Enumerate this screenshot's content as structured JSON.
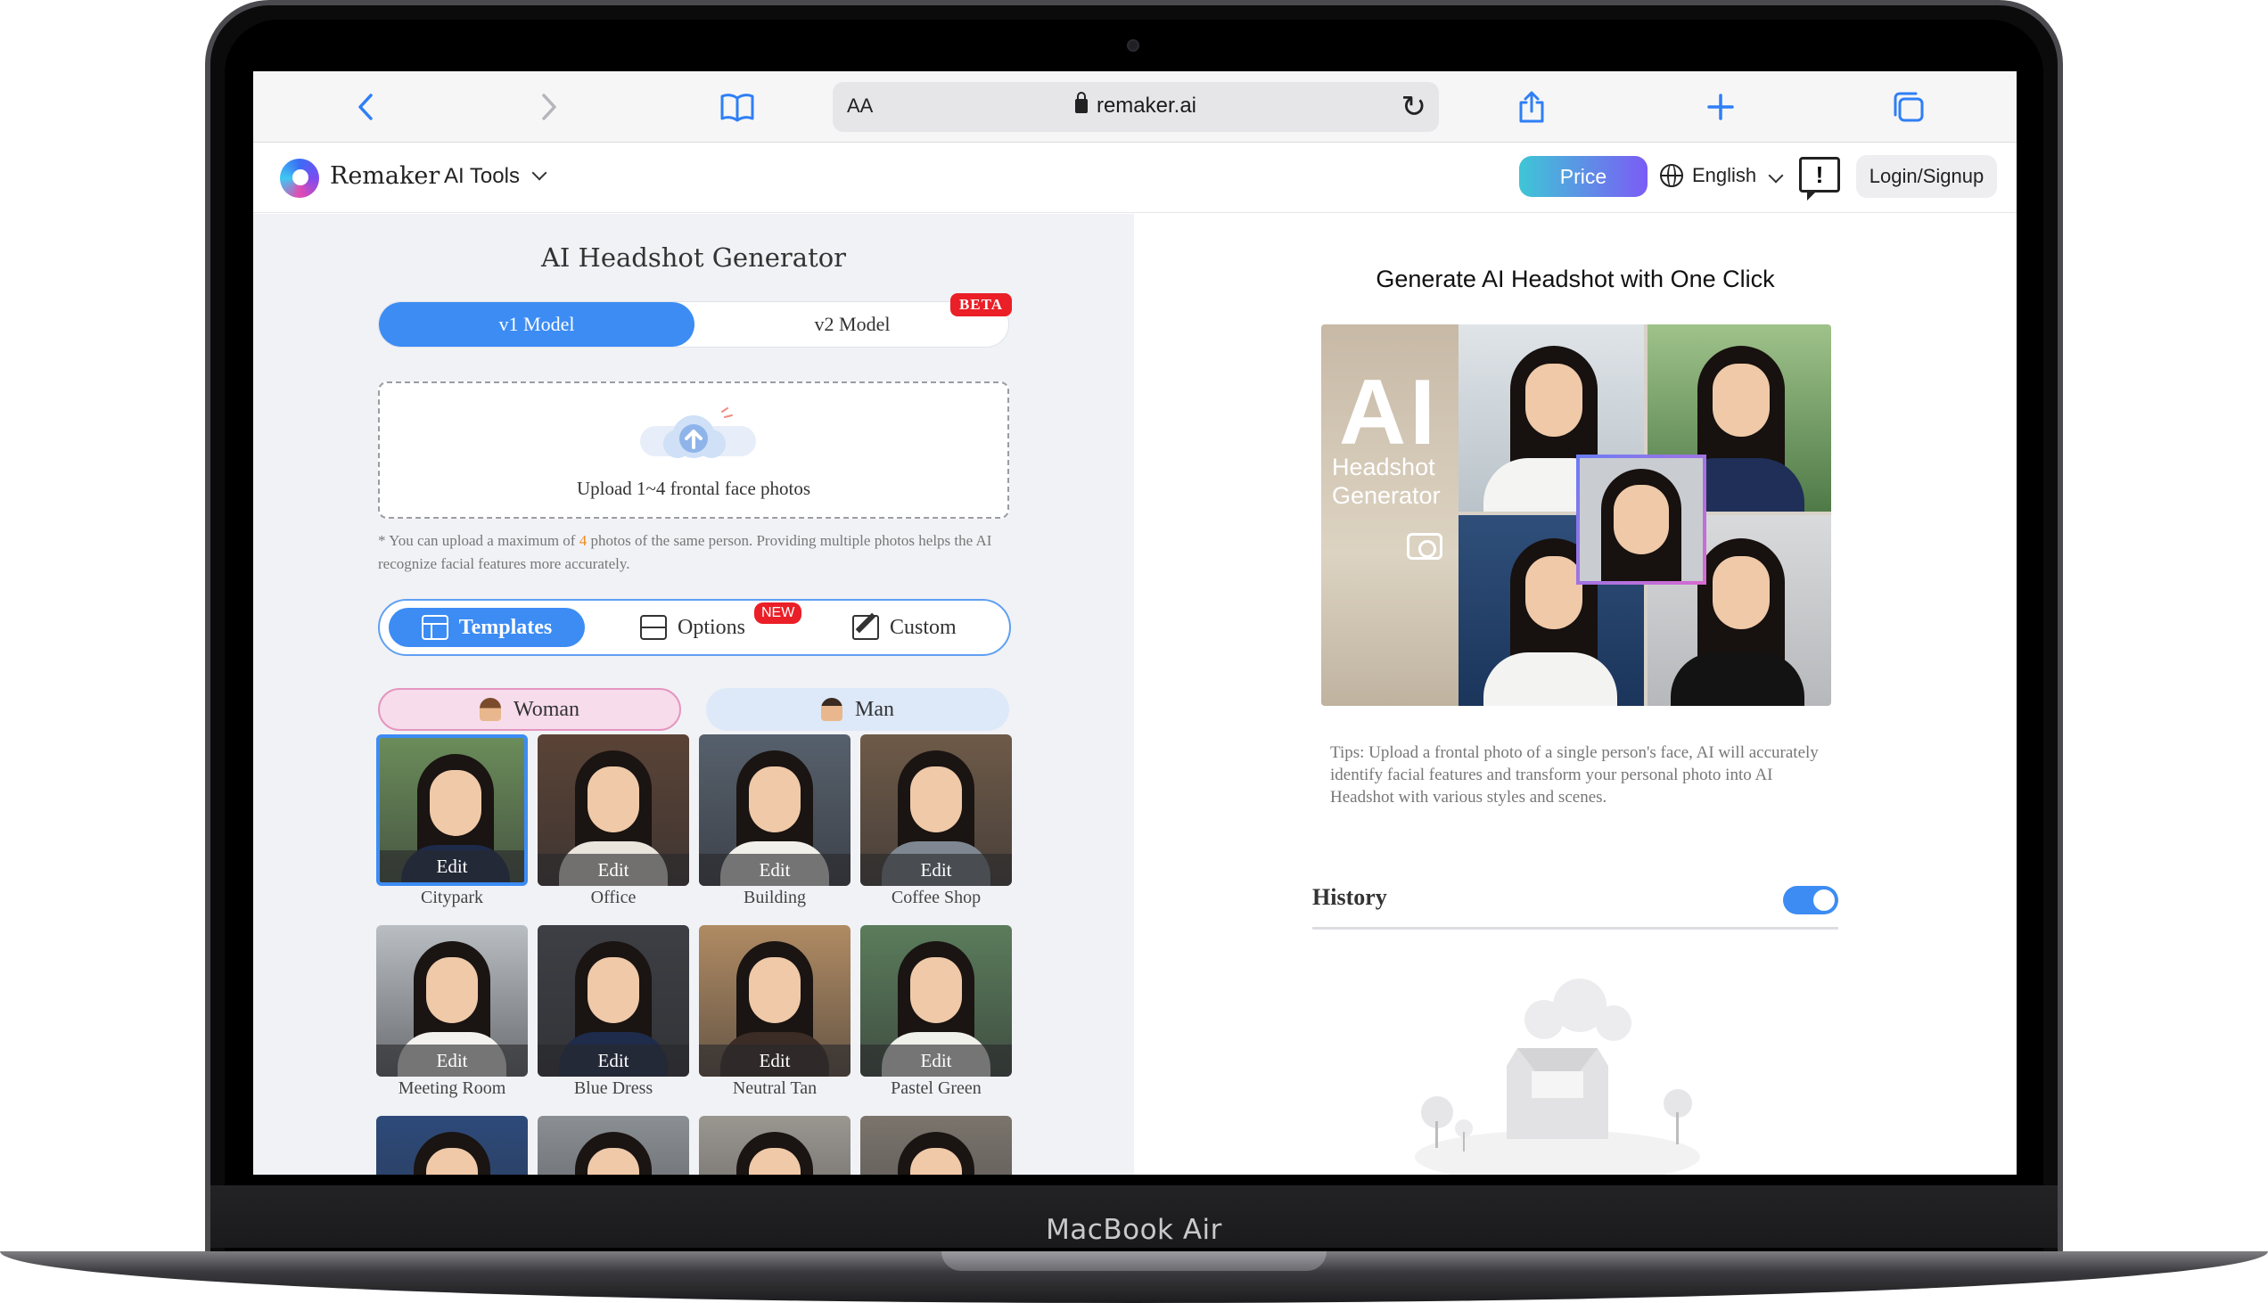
{
  "device": {
    "brand": "MacBook Air"
  },
  "browser": {
    "aa_label": "AA",
    "url": "remaker.ai",
    "icons": [
      "back-icon",
      "forward-icon",
      "bookmarks-icon",
      "lock-icon",
      "reload-icon",
      "share-icon",
      "new-tab-icon",
      "tabs-icon"
    ]
  },
  "header": {
    "brand": "Remaker",
    "menu": "AI Tools",
    "price": "Price",
    "language": "English",
    "feedback_glyph": "!",
    "login": "Login/Signup"
  },
  "left": {
    "title": "AI Headshot Generator",
    "models": {
      "v1": "v1 Model",
      "v2": "v2 Model",
      "beta": "BETA"
    },
    "upload": {
      "text": "Upload 1~4 frontal face photos",
      "note_prefix": "* You can upload a maximum of ",
      "note_count": "4",
      "note_suffix": " photos of the same person. Providing multiple photos helps the AI recognize facial features more accurately."
    },
    "modes": {
      "templates": "Templates",
      "options": "Options",
      "new": "NEW",
      "custom": "Custom"
    },
    "gender": {
      "woman": "Woman",
      "man": "Man"
    },
    "edit_label": "Edit",
    "templates": [
      {
        "label": "Citypark",
        "selected": true,
        "bg": "#6b8c5a",
        "outfit": "#1d2a4a"
      },
      {
        "label": "Office",
        "selected": false,
        "bg": "#5a4336",
        "outfit": "#e9e4dc"
      },
      {
        "label": "Building",
        "selected": false,
        "bg": "#56606c",
        "outfit": "#f1efe9"
      },
      {
        "label": "Coffee Shop",
        "selected": false,
        "bg": "#6e5a48",
        "outfit": "#7f8892"
      },
      {
        "label": "Meeting Room",
        "selected": false,
        "bg": "#b9bec2",
        "outfit": "#f3f2ef"
      },
      {
        "label": "Blue Dress",
        "selected": false,
        "bg": "#3d3f44",
        "outfit": "#1e2b4a"
      },
      {
        "label": "Neutral Tan",
        "selected": false,
        "bg": "#b08b63",
        "outfit": "#3b2c25"
      },
      {
        "label": "Pastel Green",
        "selected": false,
        "bg": "#5b7c5b",
        "outfit": "#f1f1ec"
      },
      {
        "label": "",
        "selected": false,
        "bg": "#2d4a7a",
        "outfit": "#2d4a7a"
      },
      {
        "label": "",
        "selected": false,
        "bg": "#8a8f94",
        "outfit": "#1b1b1d"
      },
      {
        "label": "",
        "selected": false,
        "bg": "#9a9690",
        "outfit": "#c8a57a"
      },
      {
        "label": "",
        "selected": false,
        "bg": "#7a746c",
        "outfit": "#151515"
      }
    ]
  },
  "right": {
    "title": "Generate AI Headshot with One Click",
    "hero": {
      "ai": "AI",
      "line1": "Headshot",
      "line2": "Generator"
    },
    "tips": "Tips: Upload a frontal photo of a single person's face, AI will accurately identify facial features and transform your personal photo into AI Headshot with various styles and scenes.",
    "history": "History",
    "history_enabled": true
  },
  "colors": {
    "accent": "#3c8cf4",
    "beta_red": "#ea1f27",
    "count_orange": "#f08a1c"
  }
}
